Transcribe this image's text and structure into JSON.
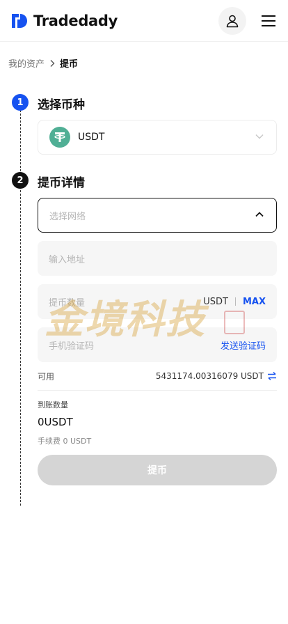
{
  "brand": {
    "name": "Tradedady",
    "color": "#1652f0"
  },
  "header": {
    "user_icon": "user-icon",
    "menu_icon": "hamburger-menu-icon"
  },
  "breadcrumb": {
    "parent": "我的资产",
    "current": "提币"
  },
  "steps": [
    {
      "number": "1",
      "title": "选择币种",
      "color": "#1652f0"
    },
    {
      "number": "2",
      "title": "提币详情",
      "color": "#111111"
    }
  ],
  "coin": {
    "selected": "USDT",
    "icon": "tether-icon",
    "icon_color": "#50af95"
  },
  "network": {
    "placeholder": "选择网络"
  },
  "address": {
    "placeholder": "输入地址"
  },
  "amount": {
    "placeholder": "提币数量",
    "unit": "USDT",
    "max_label": "MAX"
  },
  "verification": {
    "placeholder": "手机验证码",
    "send_label": "发送验证码"
  },
  "available": {
    "label": "可用",
    "value": "5431174.00316079 USDT"
  },
  "receive": {
    "label": "到账数量",
    "value": "0USDT",
    "fee": "手续费 0 USDT"
  },
  "submit": {
    "label": "提币"
  },
  "watermark": {
    "text": "金境科技"
  }
}
